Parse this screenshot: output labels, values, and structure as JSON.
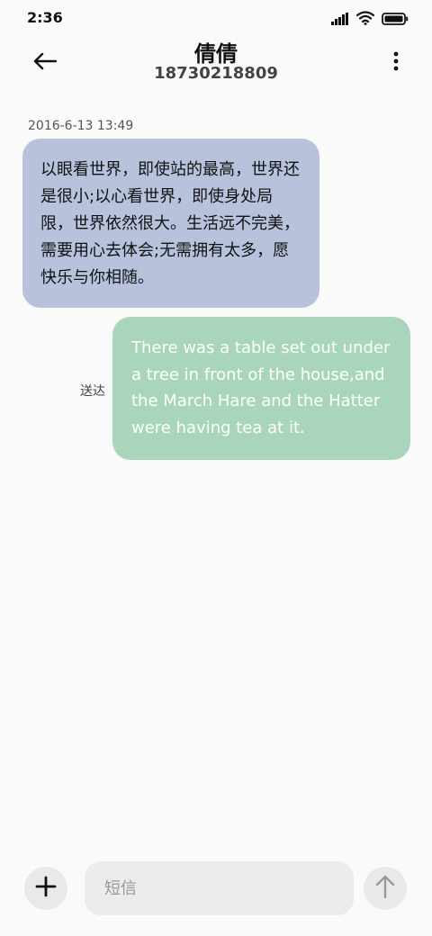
{
  "status_bar": {
    "time": "2:36",
    "icons": [
      "signal-icon",
      "wifi-icon",
      "battery-icon"
    ]
  },
  "header": {
    "contact_name": "倩倩",
    "contact_number": "18730218809",
    "icons": {
      "back": "back-arrow-icon",
      "more": "more-vertical-icon"
    }
  },
  "conversation": {
    "timestamp": "2016-6-13 13:49",
    "messages": [
      {
        "direction": "received",
        "text": "以眼看世界，即使站的最高，世界还是很小;以心看世界，即使身处局限，世界依然很大。生活远不完美，需要用心去体会;无需拥有太多，愿快乐与你相随。"
      },
      {
        "direction": "sent",
        "status": "送达",
        "text": "There was a table set out under a tree in front of the house,and the March Hare and the Hatter were having tea at it."
      }
    ]
  },
  "composer": {
    "placeholder": "短信",
    "value": "",
    "icons": {
      "attach": "plus-icon",
      "send": "send-arrow-icon"
    }
  },
  "colors": {
    "background": "#fafafa",
    "received_bubble": "#b7c3dc",
    "sent_bubble": "#a8d5bb",
    "input_background": "#ececec"
  }
}
